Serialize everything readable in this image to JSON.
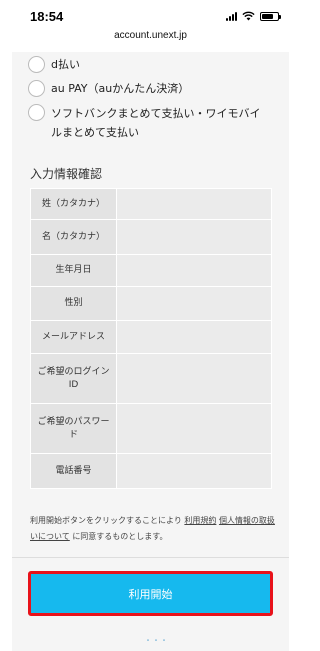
{
  "status_bar": {
    "time": "18:54"
  },
  "browser": {
    "url": "account.unext.jp"
  },
  "payment_options": [
    {
      "label": "d払い"
    },
    {
      "label": "au PAY（auかんたん決済）"
    },
    {
      "label": "ソフトバンクまとめて支払い・ワイモバイルまとめて支払い"
    }
  ],
  "confirm": {
    "title": "入力情報確認",
    "rows": [
      {
        "label": "姓（カタカナ）",
        "value": ""
      },
      {
        "label": "名（カタカナ）",
        "value": ""
      },
      {
        "label": "生年月日",
        "value": ""
      },
      {
        "label": "性別",
        "value": ""
      },
      {
        "label": "メールアドレス",
        "value": ""
      },
      {
        "label": "ご希望のログインID",
        "value": ""
      },
      {
        "label": "ご希望のパスワード",
        "value": ""
      },
      {
        "label": "電話番号",
        "value": ""
      }
    ]
  },
  "note": {
    "prefix": "利用開始ボタンをクリックすることにより",
    "terms_link": "利用規約",
    "privacy_link": "個人情報の取扱いについて",
    "suffix": "に同意するものとします。"
  },
  "start_button": {
    "label": "利用開始"
  },
  "colors": {
    "button": "#16b9ee",
    "button_border": "#e8121a"
  }
}
